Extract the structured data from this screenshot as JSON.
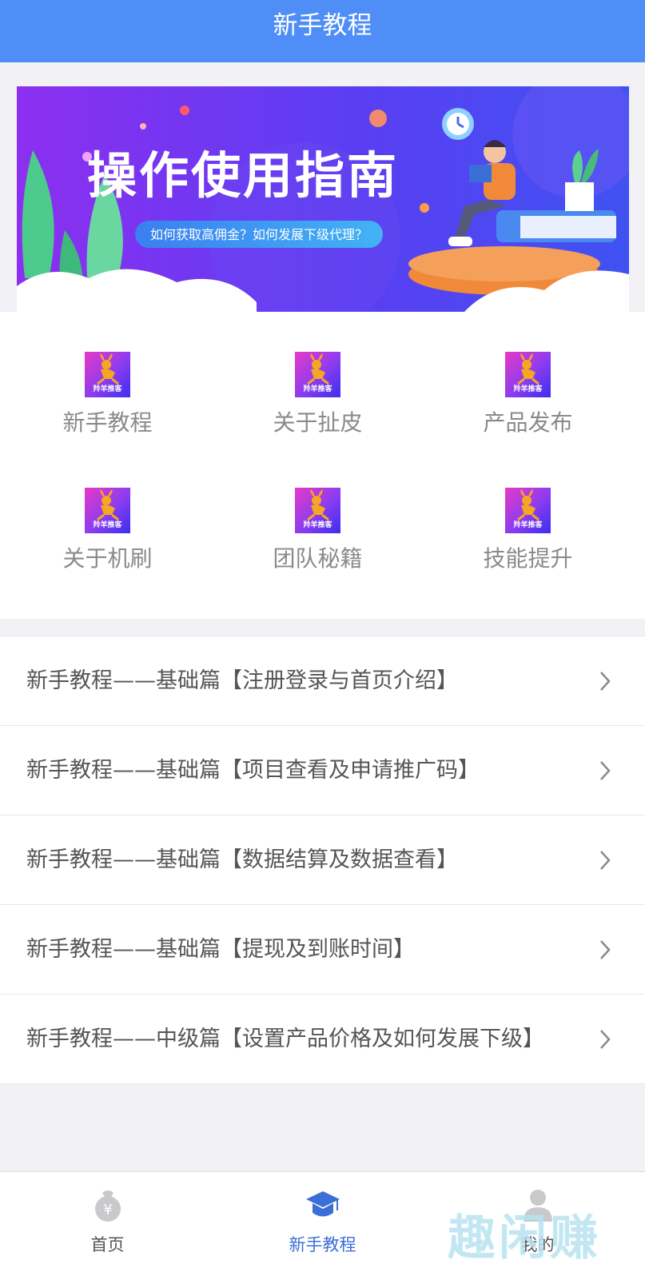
{
  "header": {
    "title": "新手教程"
  },
  "banner": {
    "headline": "操作使用指南",
    "subtitle": "如何获取高佣金？如何发展下级代理？"
  },
  "grid": {
    "logo_text": "羚羊推客",
    "items": [
      {
        "label": "新手教程"
      },
      {
        "label": "关于扯皮"
      },
      {
        "label": "产品发布"
      },
      {
        "label": "关于机刷"
      },
      {
        "label": "团队秘籍"
      },
      {
        "label": "技能提升"
      }
    ]
  },
  "list": {
    "items": [
      {
        "title": "新手教程——基础篇【注册登录与首页介绍】"
      },
      {
        "title": "新手教程——基础篇【项目查看及申请推广码】"
      },
      {
        "title": "新手教程——基础篇【数据结算及数据查看】"
      },
      {
        "title": "新手教程——基础篇【提现及到账时间】"
      },
      {
        "title": "新手教程——中级篇【设置产品价格及如何发展下级】"
      }
    ]
  },
  "tabbar": {
    "tabs": [
      {
        "label": "首页",
        "icon": "money-bag-icon",
        "active": false
      },
      {
        "label": "新手教程",
        "icon": "graduation-cap-icon",
        "active": true
      },
      {
        "label": "我的",
        "icon": "user-icon",
        "active": false
      }
    ]
  },
  "watermark": {
    "text": "趣闲赚"
  },
  "colors": {
    "header": "#4f8ef7",
    "active_tab": "#3b6fd8",
    "text": "#555555",
    "muted": "#8a8a8a"
  }
}
